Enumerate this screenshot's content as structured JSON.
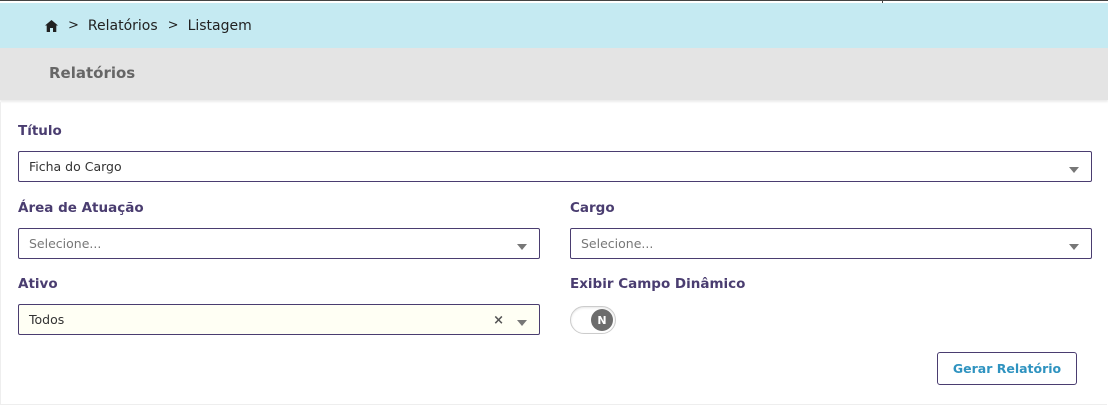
{
  "breadcrumb": {
    "separator": ">",
    "items": [
      "Relatórios",
      "Listagem"
    ]
  },
  "header": {
    "title": "Relatórios"
  },
  "form": {
    "titulo": {
      "label": "Título",
      "value": "Ficha do Cargo"
    },
    "area": {
      "label": "Área de Atuação",
      "placeholder": "Selecione..."
    },
    "cargo": {
      "label": "Cargo",
      "placeholder": "Selecione..."
    },
    "ativo": {
      "label": "Ativo",
      "value": "Todos",
      "clear": "×"
    },
    "campo_dinamico": {
      "label": "Exibir Campo Dinâmico",
      "toggle_text": "N"
    },
    "submit_label": "Gerar Relatório"
  },
  "colors": {
    "accent": "#4a3d70",
    "breadcrumb_bg": "#c5eaf2",
    "button_text": "#2f93c0"
  }
}
